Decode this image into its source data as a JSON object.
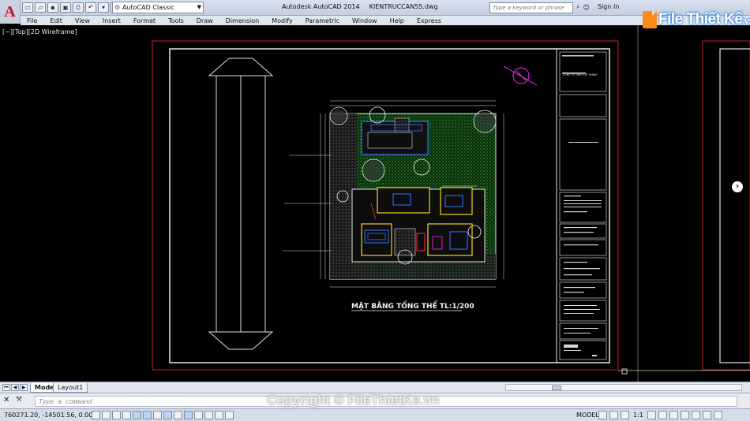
{
  "app": {
    "window_title": "Autodesk AutoCAD 2014",
    "file_name": "KIENTRUCCAN55.dwg",
    "logo_letter": "A",
    "workspace": "AutoCAD Classic",
    "search_placeholder": "Type a keyword or phrase",
    "sign_in": "Sign In"
  },
  "menu": [
    "File",
    "Edit",
    "View",
    "Insert",
    "Format",
    "Tools",
    "Draw",
    "Dimension",
    "Modify",
    "Parametric",
    "Window",
    "Help",
    "Express"
  ],
  "viewport": {
    "label": "[−][Top][2D Wireframe]"
  },
  "drawing": {
    "title": "MẶT BẰNG TỔNG THỂ  TL:1/200",
    "title_block_company": "CÔNG TY TNHH CHÍ THÀNH"
  },
  "tabs": [
    {
      "label": "Model",
      "active": true
    },
    {
      "label": "Layout1",
      "active": false
    }
  ],
  "command": {
    "prompt": "Type a command"
  },
  "status": {
    "coordinates": "760271.20, -14501.56, 0.00",
    "model": "MODEL",
    "scale": "1:1"
  },
  "watermark": {
    "logo_text": "File Thiết Kế",
    "logo_domain": ".vn",
    "copyright": "Copyright © FileThietKe.vn"
  },
  "colors": {
    "accent_red": "#c0141b",
    "drawing_frame": "#c8202a",
    "title_bar": "#c3cfdf"
  }
}
